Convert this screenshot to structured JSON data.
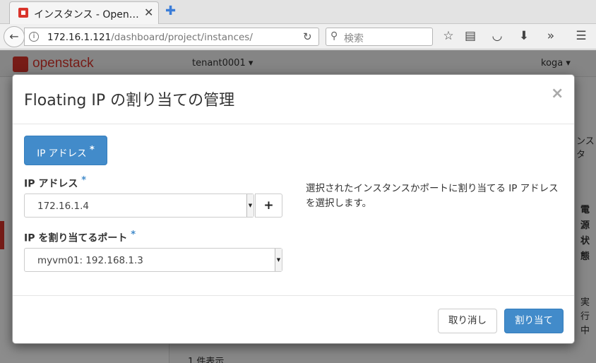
{
  "browser": {
    "tab_title": "インスタンス - Open…",
    "tab_close": "✕",
    "new_tab": "✚",
    "url_host": "172.16.1.121",
    "url_path": "/dashboard/project/instances/",
    "search_placeholder": "検索"
  },
  "app": {
    "logo_text": "openstack",
    "tenant": "tenant0001 ▾",
    "user": "koga ▾",
    "bg_fragments": {
      "count_text": "1 件表示",
      "right_col_a": "ンスタ",
      "right_col_b": "電源状態",
      "right_col_c": "実行中"
    }
  },
  "modal": {
    "title": "Floating IP の割り当ての管理",
    "close": "×",
    "tab_label": "IP アドレス",
    "required_mark": "*",
    "ip_label": "IP アドレス",
    "ip_value": "172.16.1.4",
    "add_ip": "+",
    "port_label": "IP を割り当てるポート",
    "port_value": "myvm01: 192.168.1.3",
    "help": "選択されたインスタンスかポートに割り当てる IP アドレスを選択します。",
    "cancel_label": "取り消し",
    "submit_label": "割り当て"
  },
  "colors": {
    "primary": "#428bca",
    "brand": "#d9342b"
  }
}
